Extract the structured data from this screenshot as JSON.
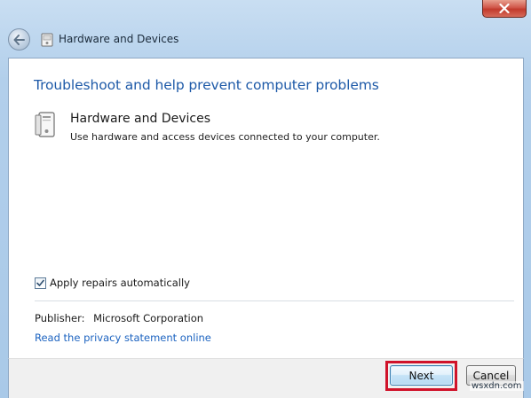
{
  "window": {
    "title": "Hardware and Devices"
  },
  "content": {
    "heading": "Troubleshoot and help prevent computer problems",
    "item": {
      "title": "Hardware and Devices",
      "description": "Use hardware and access devices connected to your computer."
    },
    "apply_repairs": {
      "label": "Apply repairs automatically",
      "checked": true
    },
    "publisher": {
      "label": "Publisher:",
      "value": "Microsoft Corporation"
    },
    "privacy_link": "Read the privacy statement online"
  },
  "footer": {
    "next_label": "Next",
    "cancel_label": "Cancel",
    "highlight_color": "#d0122a"
  },
  "watermark": "wsxdn.com",
  "icons": {
    "close": "close-icon",
    "back": "back-arrow-icon",
    "app": "troubleshooter-icon",
    "item": "hardware-device-icon",
    "check": "checkmark-icon"
  }
}
